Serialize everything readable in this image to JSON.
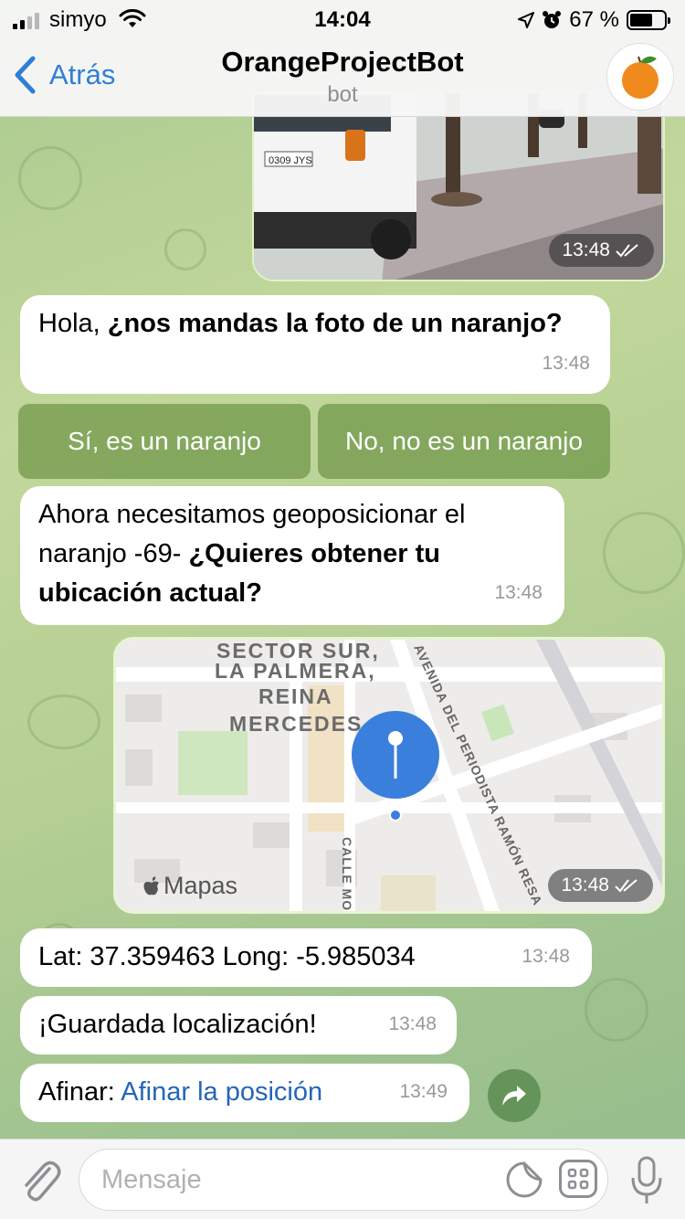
{
  "status_bar": {
    "carrier": "simyo",
    "time": "14:04",
    "battery": "67 %",
    "battery_level": 0.67
  },
  "header": {
    "back_label": "Atrás",
    "title": "OrangeProjectBot",
    "subtitle": "bot"
  },
  "messages": {
    "photo_time": "13:48",
    "photo_plate": "0309 JYS",
    "greeting_plain": "Hola, ",
    "greeting_bold": "¿nos mandas la foto de un naranjo?",
    "greeting_time": "13:48",
    "geo_plain": "Ahora necesitamos geoposicionar el naranjo -69- ",
    "geo_bold": "¿Quieres obtener tu ubicación actual?",
    "geo_time": "13:48",
    "map_time": "13:48",
    "latlong": "Lat: 37.359463 Long: -5.985034",
    "latlong_time": "13:48",
    "saved": "¡Guardada localización!",
    "saved_time": "13:48",
    "refine_label": "Afinar: ",
    "refine_link": "Afinar la posición",
    "refine_time": "13:49"
  },
  "keyboard": {
    "yes": "Sí, es un naranjo",
    "no": "No, no es un naranjo"
  },
  "map": {
    "brand": "Mapas",
    "label_sector": "SECTOR SUR,",
    "label_palmera": "LA PALMERA,",
    "label_reina": "REINA",
    "label_mercedes": "MERCEDES",
    "street_diag": "AVENIDA DEL PERIODISTA RAMÓN RESA",
    "street_calle": "CALLE MO"
  },
  "input": {
    "placeholder": "Mensaje"
  },
  "colors": {
    "accent": "#2f7fd6",
    "link": "#2466b8",
    "keyboard_button": "#6e9646",
    "pin": "#3a7fdc"
  },
  "icons": [
    "signal-icon",
    "wifi-icon",
    "location-arrow-icon",
    "alarm-icon",
    "battery-icon",
    "chevron-left-icon",
    "orange-fruit-icon",
    "double-check-icon",
    "map-pin-icon",
    "apple-logo-icon",
    "share-icon",
    "paperclip-icon",
    "sticker-icon",
    "command-icon",
    "microphone-icon"
  ]
}
